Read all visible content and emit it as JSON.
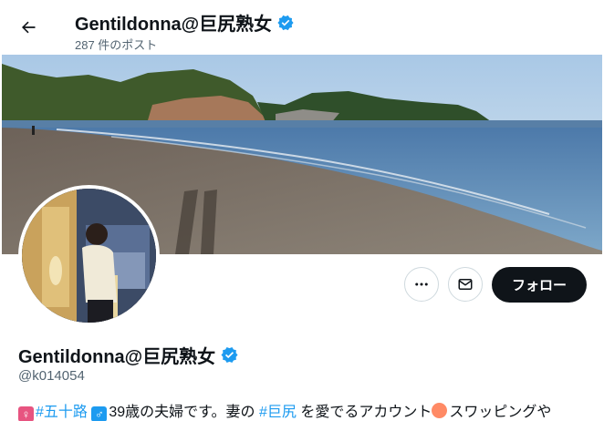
{
  "header": {
    "display_name": "Gentildonna@巨尻熟女",
    "post_count": "287 件のポスト"
  },
  "profile": {
    "display_name": "Gentildonna@巨尻熟女",
    "handle": "@k014054",
    "follow_label": "フォロー"
  },
  "bio": {
    "female_emoji": "♀",
    "tag1": "#五十路",
    "male_emoji": "♂",
    "text1": "39歳の夫婦です。妻の",
    "tag2": "#巨尻",
    "text2": "を愛でるアカウント",
    "text3": "スワッピングや"
  },
  "icons": [
    "back-arrow-icon",
    "verified-badge-icon",
    "more-icon",
    "message-icon",
    "peach-emoji-icon"
  ],
  "colors": {
    "verified": "#1d9bf0",
    "link": "#1d9bf0",
    "follow_bg": "#0f1419",
    "muted": "#536471"
  }
}
